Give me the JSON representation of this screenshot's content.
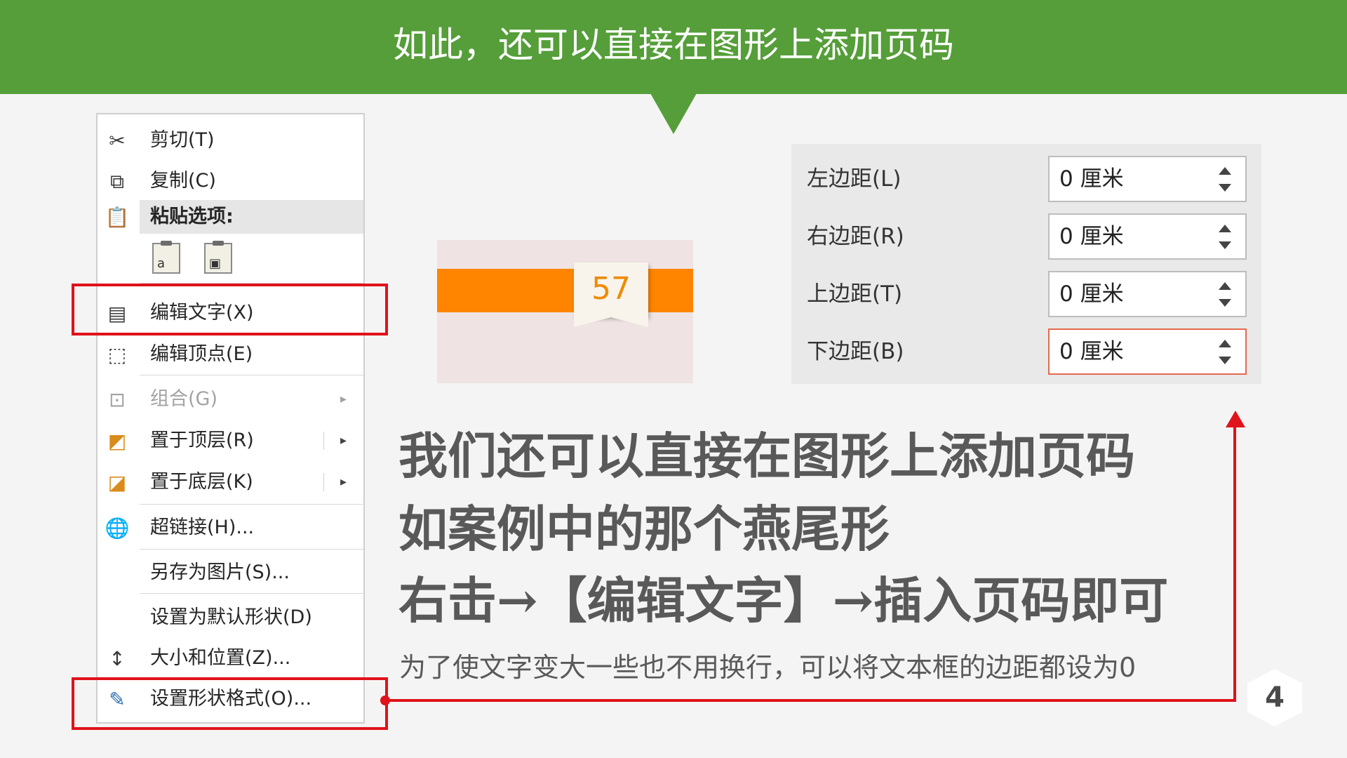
{
  "header": {
    "title": "如此，还可以直接在图形上添加页码",
    "color": "#559e39"
  },
  "menu": {
    "items": [
      {
        "label": "剪切(T)",
        "icon": "scissors-icon"
      },
      {
        "label": "复制(C)",
        "icon": "copy-icon"
      },
      {
        "label": "粘贴选项:",
        "icon": "paste-icon"
      },
      {
        "label": "编辑文字(X)",
        "icon": "edit-text-icon"
      },
      {
        "label": "编辑顶点(E)",
        "icon": "edit-points-icon"
      },
      {
        "label": "组合(G)",
        "icon": "group-icon",
        "disabled": true
      },
      {
        "label": "置于顶层(R)",
        "icon": "bring-to-front-icon"
      },
      {
        "label": "置于底层(K)",
        "icon": "send-to-back-icon"
      },
      {
        "label": "超链接(H)...",
        "icon": "hyperlink-icon"
      },
      {
        "label": "另存为图片(S)...",
        "icon": ""
      },
      {
        "label": "设置为默认形状(D)",
        "icon": ""
      },
      {
        "label": "大小和位置(Z)...",
        "icon": "size-position-icon"
      },
      {
        "label": "设置形状格式(O)...",
        "icon": "format-shape-icon"
      }
    ],
    "paste_options": [
      "keep-text-only-icon",
      "picture-icon"
    ]
  },
  "preview": {
    "page_number": "57",
    "band_color": "#ff8500"
  },
  "margins": {
    "rows": [
      {
        "label": "左边距(L)",
        "value": "0 厘米"
      },
      {
        "label": "右边距(R)",
        "value": "0 厘米"
      },
      {
        "label": "上边距(T)",
        "value": "0 厘米"
      },
      {
        "label": "下边距(B)",
        "value": "0 厘米"
      }
    ]
  },
  "body": {
    "line1": "我们还可以直接在图形上添加页码",
    "line2": "如案例中的那个燕尾形",
    "line3": "右击→【编辑文字】→插入页码即可",
    "note": "为了使文字变大一些也不用换行，可以将文本框的边距都设为0"
  },
  "page_number": "4",
  "highlight_color": "#e0121a"
}
